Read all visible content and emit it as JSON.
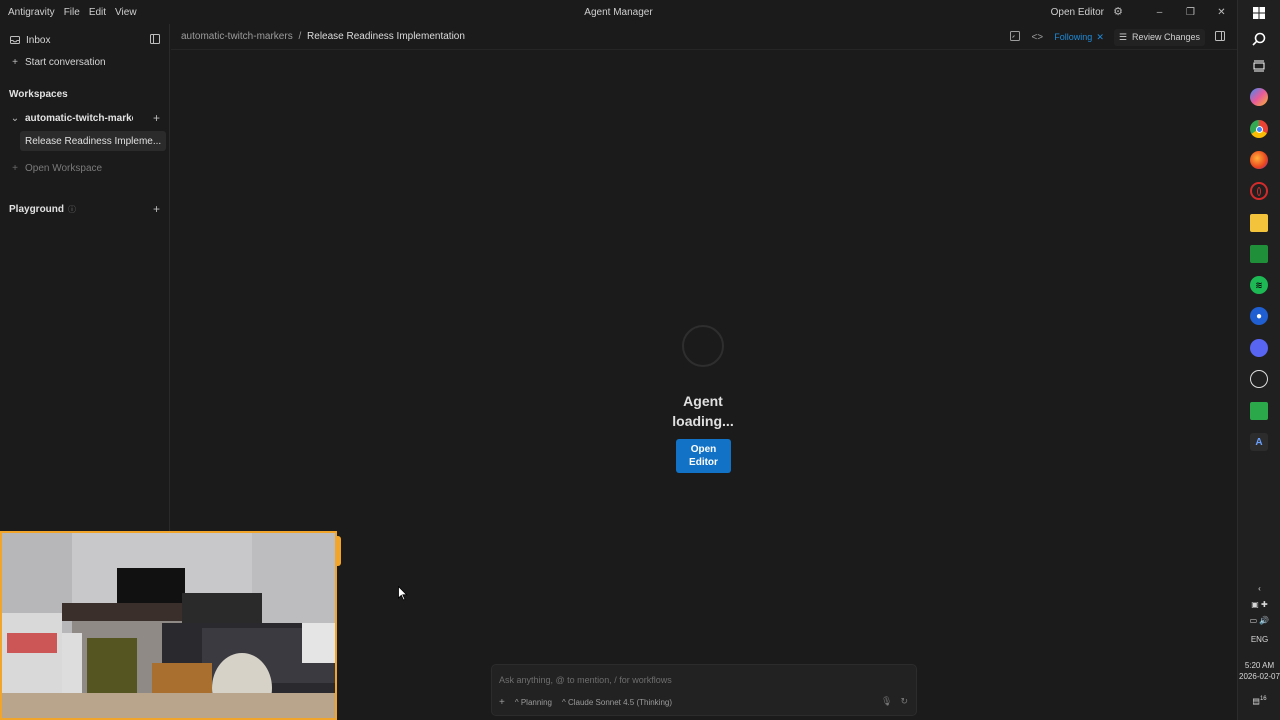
{
  "menu": [
    "Antigravity",
    "File",
    "Edit",
    "View"
  ],
  "app_title": "Agent Manager",
  "titlebar_right": {
    "open_editor": "Open Editor"
  },
  "sidebar": {
    "inbox": "Inbox",
    "start_conversation": "Start conversation",
    "workspaces_heading": "Workspaces",
    "workspace_name": "automatic-twitch-marker",
    "active_conversation": "Release Readiness Impleme...",
    "open_workspace": "Open Workspace",
    "playground": "Playground"
  },
  "breadcrumb": {
    "workspace": "automatic-twitch-markers",
    "separator": "/",
    "current": "Release Readiness Implementation"
  },
  "header": {
    "following": "Following",
    "review_changes": "Review Changes"
  },
  "center": {
    "loading_line1": "Agent",
    "loading_line2": "loading...",
    "open_editor_line1": "Open",
    "open_editor_line2": "Editor"
  },
  "composer": {
    "placeholder": "Ask anything, @ to mention, / for workflows",
    "mode": "Planning",
    "model": "Claude Sonnet 4.5 (Thinking)"
  },
  "system_tray": {
    "language": "ENG",
    "time": "5:20 AM",
    "date": "2026-02-07",
    "notification_count": "16"
  },
  "colors": {
    "accent": "#1273c6",
    "following": "#1f8ad7",
    "webcam_border": "#f1a52a",
    "background": "#1b1b1b"
  }
}
